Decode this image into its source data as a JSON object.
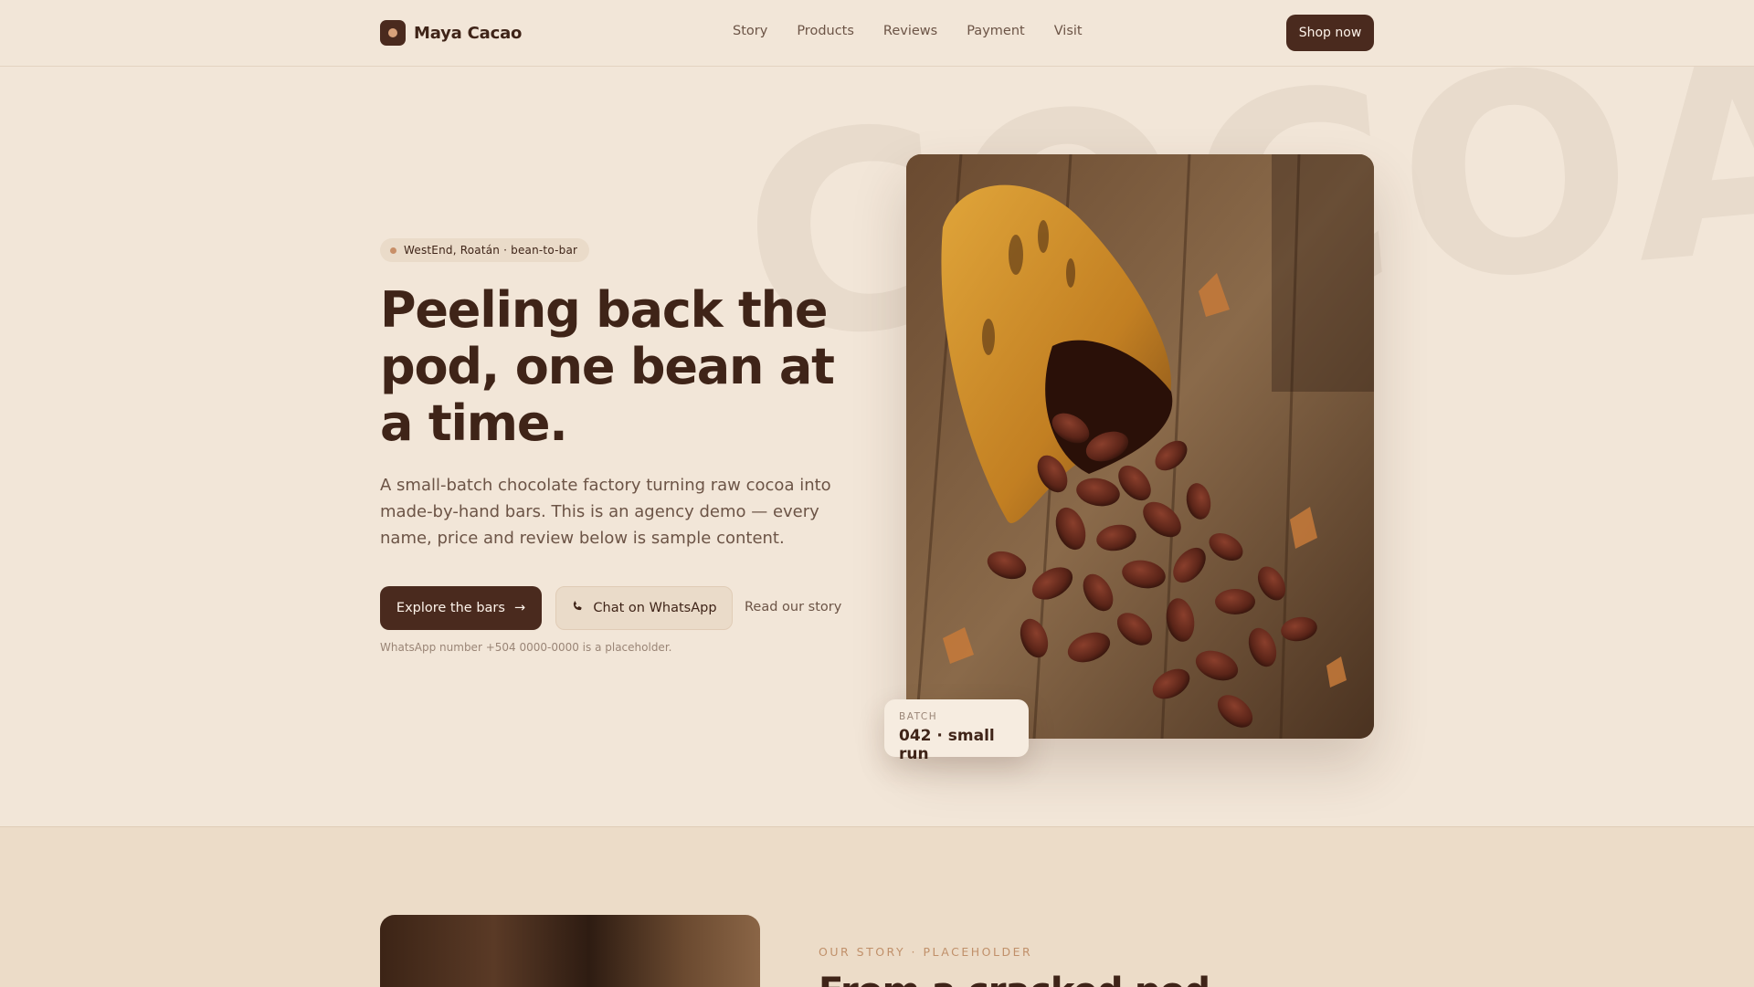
{
  "header": {
    "brand": "Maya Cacao",
    "nav": [
      "Story",
      "Products",
      "Reviews",
      "Payment",
      "Visit"
    ],
    "cta": "Shop now"
  },
  "hero": {
    "watermark": "COCOA",
    "badge": "WestEnd, Roatán · bean-to-bar",
    "headline": "Peeling back the pod, one bean at a time.",
    "subtitle": "A small-batch chocolate factory turning raw cocoa into made-by-hand bars. This is an agency demo — every name, price and review below is sample content.",
    "primary_button": "Explore the bars",
    "primary_arrow": "→",
    "secondary_button": "Chat on WhatsApp",
    "story_link": "Read our story",
    "note": "WhatsApp number +504 0000-0000 is a placeholder.",
    "batch_label": "BATCH",
    "batch_value": "042 · small run"
  },
  "story": {
    "eyebrow": "OUR STORY · PLACEHOLDER",
    "title": "From a cracked pod"
  },
  "colors": {
    "background": "#f2e6d8",
    "primary": "#4a2a1e",
    "accent": "#c88f68"
  },
  "icons": [
    "phone-icon",
    "arrow-right-icon"
  ]
}
